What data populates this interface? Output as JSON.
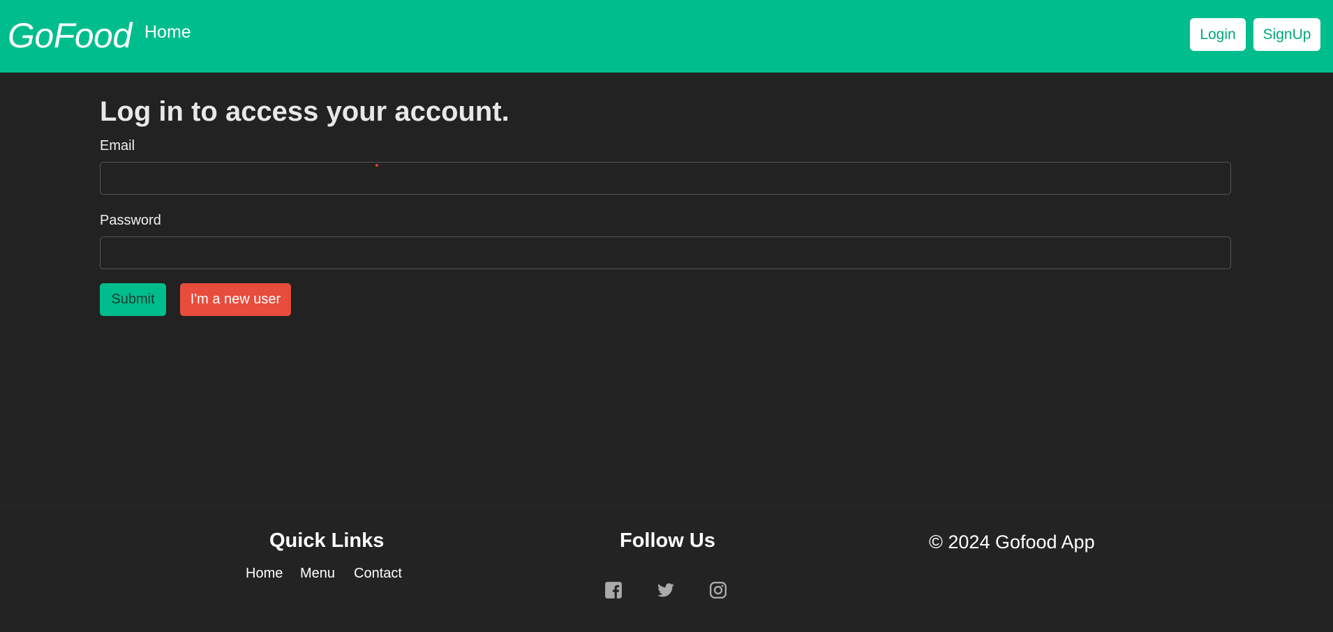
{
  "colors": {
    "brand_green": "#00bd8d",
    "danger_red": "#e74c3c",
    "page_background": "#222222"
  },
  "navbar": {
    "brand": "GoFood",
    "home_link": "Home",
    "login_button": "Login",
    "signup_button": "SignUp"
  },
  "login_form": {
    "title": "Log in to access your account.",
    "email_label": "Email",
    "email_value": "",
    "password_label": "Password",
    "password_value": "",
    "submit_button": "Submit",
    "new_user_button": "I'm a new user"
  },
  "footer": {
    "quick_links_title": "Quick Links",
    "quick_links": [
      "Home",
      "Menu",
      "Contact"
    ],
    "follow_us_title": "Follow Us",
    "social_icons": [
      "facebook-icon",
      "twitter-icon",
      "instagram-icon"
    ],
    "copyright": "© 2024 Gofood App"
  }
}
